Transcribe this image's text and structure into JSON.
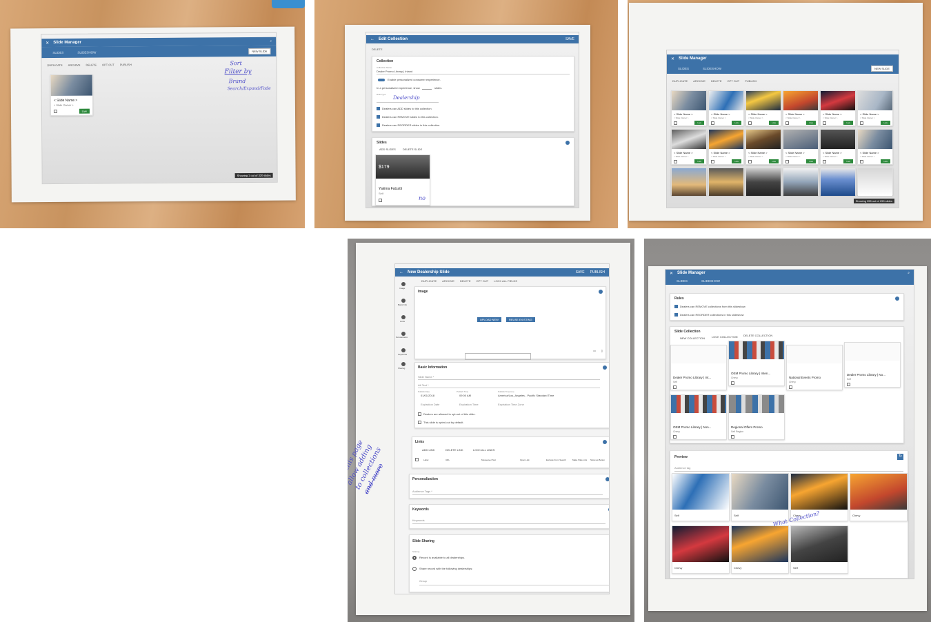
{
  "colors": {
    "appbar": "#3d72a8",
    "wood": "#cc9966",
    "paper": "#f4f4f2",
    "ink": "#4a4ac8"
  },
  "p1": {
    "title": "Slide Manager",
    "tabs": [
      "SLIDES",
      "SLIDESHOW"
    ],
    "new_slide": "NEW SLIDE",
    "toolbar": [
      "DUPLICATE",
      "ARCHIVE",
      "DELETE",
      "OPT OUT",
      "PUBLISH"
    ],
    "card": {
      "name": "< Slide Name >",
      "sub": "< Slide Owner >",
      "badge": "Live"
    },
    "note": [
      "Sort",
      "Filter by",
      "Brand",
      "Search/Expand/Fade"
    ],
    "showing": "Showing 1 out of 320 slides"
  },
  "p2": {
    "title": "Edit Collection",
    "save": "SAVE",
    "toolbar": [
      "DELETE"
    ],
    "collection_title": "Collection",
    "collection_name_label": "Collection Name",
    "collection_name": "Dealer Promo Library | Inland",
    "toggle_label": "Enable personalized consumer experience.",
    "personalized": "In a personalized experience, show",
    "slides_word": "slides.",
    "role_label": "Role Type",
    "role_value": "Dealership",
    "checks": [
      "Dealers can ADD slides to this collection",
      "Dealers can REMOVE slides to this collection.",
      "Dealers can REORDER slides in this collection."
    ],
    "slides_title": "Slides",
    "add_slides": "ADD SLIDES",
    "delete_slide": "DELETE SLIDE",
    "card_name": "Yakima Fatcatti",
    "card_sub": "Self",
    "price": "$179",
    "note": "no"
  },
  "p3": {
    "title": "Slide Manager",
    "tabs": [
      "SLIDES",
      "SLIDESHOW"
    ],
    "new_slide": "NEW SLIDE",
    "toolbar": [
      "DUPLICATE",
      "ARCHIVE",
      "DELETE",
      "OPT OUT",
      "PUBLISH"
    ],
    "card_name": "< Slide Name >",
    "card_sub": "< Slide Owner >",
    "badge": "Live",
    "showing": "Showing 255 out of 250 slides"
  },
  "p4": {
    "title": "New Dealership Slide",
    "save": "SAVE",
    "publish": "PUBLISH",
    "toolbar": [
      "DUPLICATE",
      "ARCHIVE",
      "DELETE",
      "OPT OUT",
      "LOCK ALL FIELDS"
    ],
    "nav": [
      "Image",
      "Basic Info",
      "Links",
      "Personalization",
      "Keywords",
      "Sharing"
    ],
    "image_title": "Image",
    "upload_new": "UPLOAD NEW",
    "reuse_existing": "REUSE EXISTING",
    "basic_title": "Basic Information",
    "slide_name": "Slide Name *",
    "alt_text": "Alt Text *",
    "publish_date_label": "Publish Date",
    "publish_date": "01/01/2018",
    "publish_time_label": "Publish Time",
    "publish_time": "09:00 AM",
    "tz_label": "Publish Timezone",
    "tz_value": "America/Los_Angeles - Pacific Standard Time",
    "exp_date": "Expiration Date",
    "exp_time": "Expiration Time",
    "exp_tz": "Expiration Time Zone",
    "opt_out_1": "Dealers are allowed to opt-out of this slide.",
    "opt_out_2": "This slide is opted-out by default.",
    "links_title": "Links",
    "add_link": "ADD LINK",
    "delete_link": "DELETE LINK",
    "lock_all_links": "LOCK ALL LINKS",
    "link_cols": [
      "Label",
      "URL",
      "Mouseover Text",
      "Open Link",
      "Exclude From Search",
      "Make Slide Link",
      "Show as Button"
    ],
    "pers_title": "Personalization",
    "audience_tags": "Audience Tags *",
    "keywords_title": "Keywords",
    "keywords": "Keywords",
    "sharing_title": "Slide Sharing",
    "sharing_label": "Sharing",
    "share_1": "Record is available to all dealerships.",
    "share_2": "Share record with the following dealerships:",
    "group": "Group",
    "note": [
      "On this page",
      "allow adding",
      "to collections",
      "and more"
    ]
  },
  "p5": {
    "title": "Slide Manager",
    "tabs": [
      "SLIDES",
      "SLIDESHOW"
    ],
    "rules_title": "Rules",
    "rules": [
      "Dealers can REMOVE collections from this slideshow",
      "Dealers can REORDER collections in this slideshow"
    ],
    "collection_title": "Slide Collection",
    "collection_toolbar": [
      "NEW COLLECTION",
      "LOCK COLLECTION",
      "DELETE COLLECTION"
    ],
    "collections": [
      {
        "name": "Dealer Promo Library | Int...",
        "sub": "Self"
      },
      {
        "name": "OEM Promo Library | Inten...",
        "sub": "Chevy"
      },
      {
        "name": "National Events Promo",
        "sub": "Chevy"
      },
      {
        "name": "Dealer Promo Library | No...",
        "sub": "Self"
      },
      {
        "name": "OEM Promo Library | Non...",
        "sub": "Chevy"
      },
      {
        "name": "Regional Offers Promo",
        "sub": "Self Region"
      }
    ],
    "preview_title": "Preview",
    "audience_tag": "Audience tag",
    "preview_labels": [
      "Self",
      "Self",
      "Chevy",
      "Chevy",
      "Chevy",
      "Chevy",
      "Self"
    ],
    "note": "What Collection?",
    "prices": [
      "$219",
      "$239",
      "$15.00",
      "$179"
    ]
  }
}
